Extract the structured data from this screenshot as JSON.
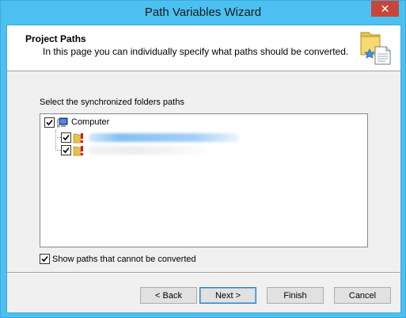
{
  "window": {
    "title": "Path Variables Wizard",
    "close_glyph": "✕",
    "accent_color": "#4cc0f0",
    "close_color": "#c7463a"
  },
  "header": {
    "title": "Project Paths",
    "description": "In this page you can individually specify what paths should be converted.",
    "icon": "folder-document-icon"
  },
  "main": {
    "section_label": "Select the synchronized folders paths",
    "tree": {
      "root": {
        "label": "Computer",
        "checked": true,
        "icon": "computer-icon"
      },
      "children": [
        {
          "checked": true,
          "icon": "folder-warning-icon"
        },
        {
          "checked": true,
          "icon": "folder-warning-icon"
        }
      ]
    },
    "show_paths": {
      "label": "Show paths that cannot be converted",
      "checked": true
    }
  },
  "footer": {
    "back_label": "< Back",
    "next_label": "Next >",
    "finish_label": "Finish",
    "cancel_label": "Cancel"
  }
}
